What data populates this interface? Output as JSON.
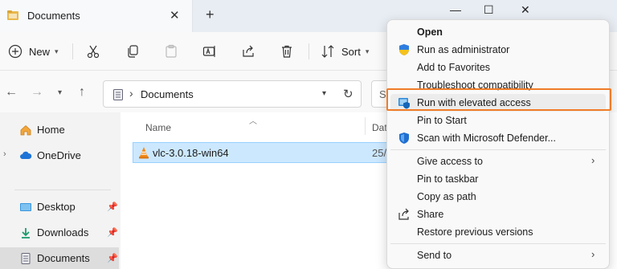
{
  "window": {
    "tab_title": "Documents",
    "close_tab": "✕",
    "new_tab": "+",
    "minimize": "—",
    "maximize": "☐",
    "close": "✕"
  },
  "command_bar": {
    "new_label": "New",
    "sort_label": "Sort"
  },
  "address_bar": {
    "path": "Documents",
    "search_placeholder": "Se"
  },
  "sidebar": {
    "items": [
      {
        "label": "Home"
      },
      {
        "label": "OneDrive"
      },
      {
        "label": "Desktop"
      },
      {
        "label": "Downloads"
      },
      {
        "label": "Documents"
      }
    ]
  },
  "file_list": {
    "columns": {
      "name": "Name",
      "date": "Dat"
    },
    "rows": [
      {
        "name": "vlc-3.0.18-win64",
        "date": "25/"
      }
    ]
  },
  "context_menu": {
    "items": [
      {
        "label": "Open",
        "bold": true
      },
      {
        "label": "Run as administrator",
        "icon": "uac-shield-icon"
      },
      {
        "label": "Add to Favorites"
      },
      {
        "label": "Troubleshoot compatibility"
      },
      {
        "label": "Run with elevated access",
        "icon": "elevated-access-icon",
        "highlighted": true
      },
      {
        "label": "Pin to Start"
      },
      {
        "label": "Scan with Microsoft Defender...",
        "icon": "defender-shield-icon"
      },
      {
        "label": "Give access to",
        "submenu": true
      },
      {
        "label": "Pin to taskbar"
      },
      {
        "label": "Copy as path"
      },
      {
        "label": "Share",
        "icon": "share-icon"
      },
      {
        "label": "Restore previous versions"
      },
      {
        "label": "Send to",
        "submenu": true
      }
    ]
  },
  "colors": {
    "highlight_border": "#f07c28",
    "selection_bg": "#cce8ff",
    "accent": "#0067c0"
  }
}
